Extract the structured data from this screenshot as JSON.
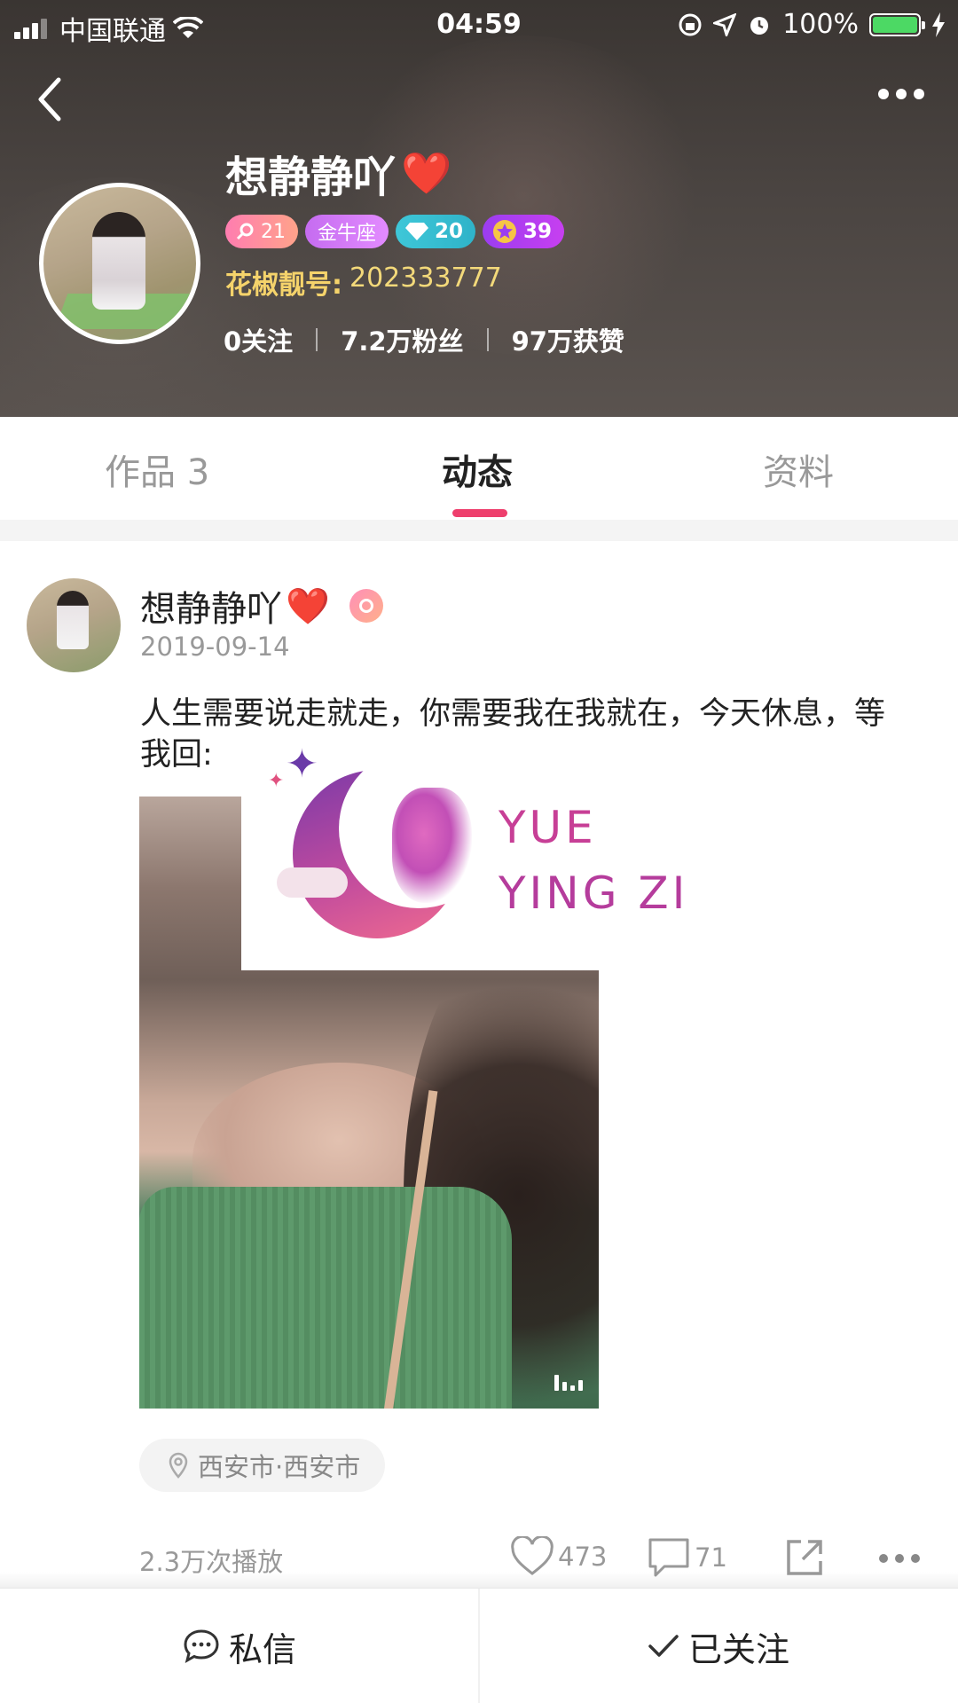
{
  "status_bar": {
    "carrier": "中国联通",
    "time": "04:59",
    "battery": "100%"
  },
  "profile": {
    "name": "想静静吖",
    "name_emoji": "❤️",
    "badges": {
      "gender_level": "21",
      "zodiac": "金牛座",
      "diamond": "20",
      "level": "39"
    },
    "id_label": "花椒靓号:",
    "id_value": "202333777",
    "stats": {
      "following": "0关注",
      "fans": "7.2万粉丝",
      "likes": "97万获赞"
    }
  },
  "tabs": [
    {
      "label": "作品 3"
    },
    {
      "label": "动态"
    },
    {
      "label": "资料"
    }
  ],
  "post": {
    "author": "想静静吖",
    "author_emoji": "❤️",
    "date": "2019-09-14",
    "text": "人生需要说走就走，你需要我在我就在，今天休息，等我回:",
    "watermark_line1": "YUE",
    "watermark_line2": "YING ZI",
    "location": "西安市·西安市",
    "plays": "2.3万次播放",
    "likes": "473",
    "comments": "71"
  },
  "bottom_bar": {
    "message_label": "私信",
    "follow_label": "已关注"
  },
  "colors": {
    "accent": "#ee3f6d",
    "id_gold": "#f5d36b",
    "battery_green": "#4cd964"
  }
}
